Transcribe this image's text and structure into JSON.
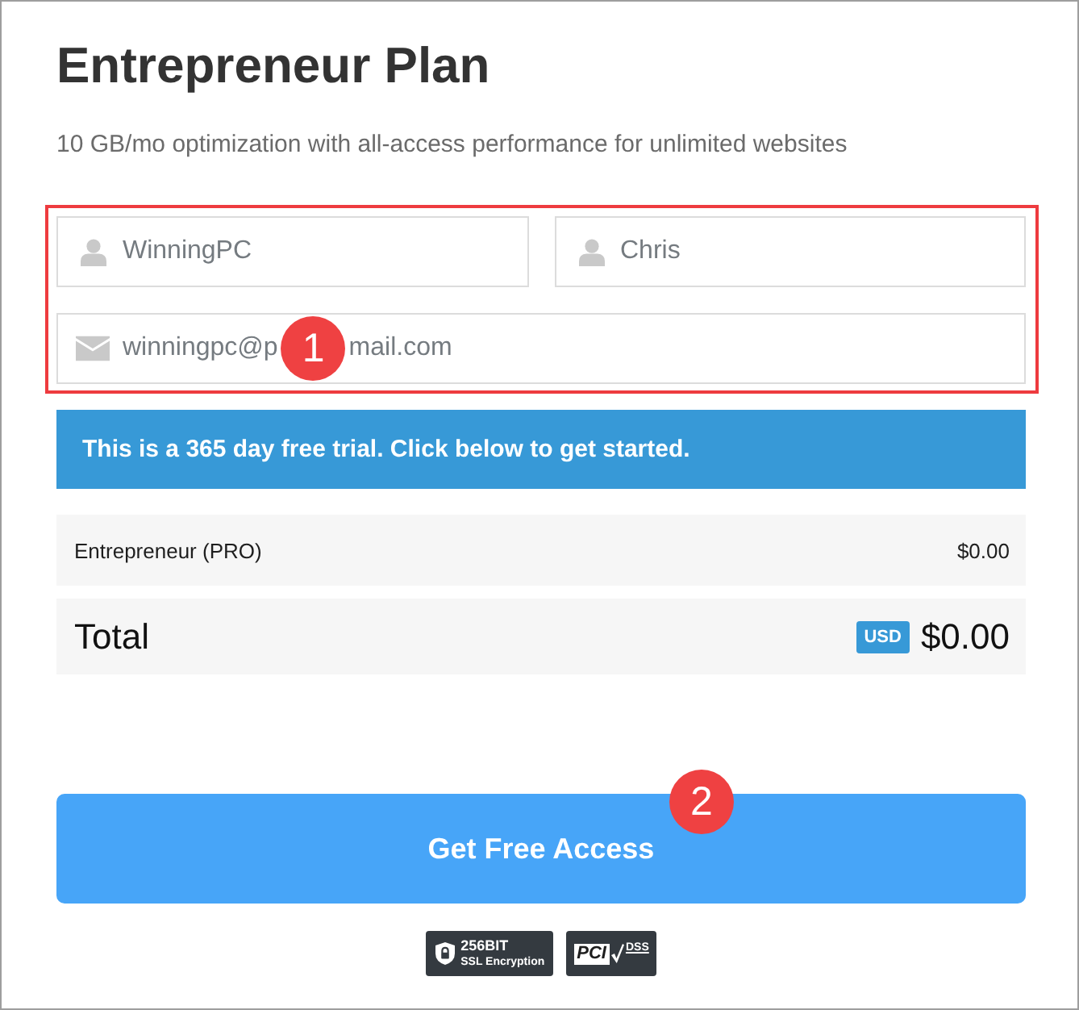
{
  "plan": {
    "title": "Entrepreneur Plan",
    "subtitle": "10 GB/mo optimization with all-access performance for unlimited websites"
  },
  "form": {
    "highlighted": true,
    "fields": [
      {
        "kind": "person",
        "value": "WinningPC"
      },
      {
        "kind": "person",
        "value": "Chris"
      },
      {
        "kind": "email",
        "value_parts": [
          "winningpc@p",
          "mail.com"
        ],
        "marker": "1"
      }
    ]
  },
  "notice": "This is a 365 day free trial. Click below to get started.",
  "summary": {
    "items": [
      {
        "label": "Entrepreneur (PRO)",
        "price": "$0.00"
      }
    ],
    "total": {
      "label": "Total",
      "currency": "USD",
      "amount": "$0.00"
    }
  },
  "button": {
    "label": "Get Free Access",
    "marker": "2"
  },
  "trust_badges": [
    {
      "kind": "ssl",
      "lines": [
        "256BIT",
        "SSL Encryption"
      ]
    },
    {
      "kind": "pci",
      "lines": [
        "PCI",
        "DSS"
      ]
    }
  ]
}
